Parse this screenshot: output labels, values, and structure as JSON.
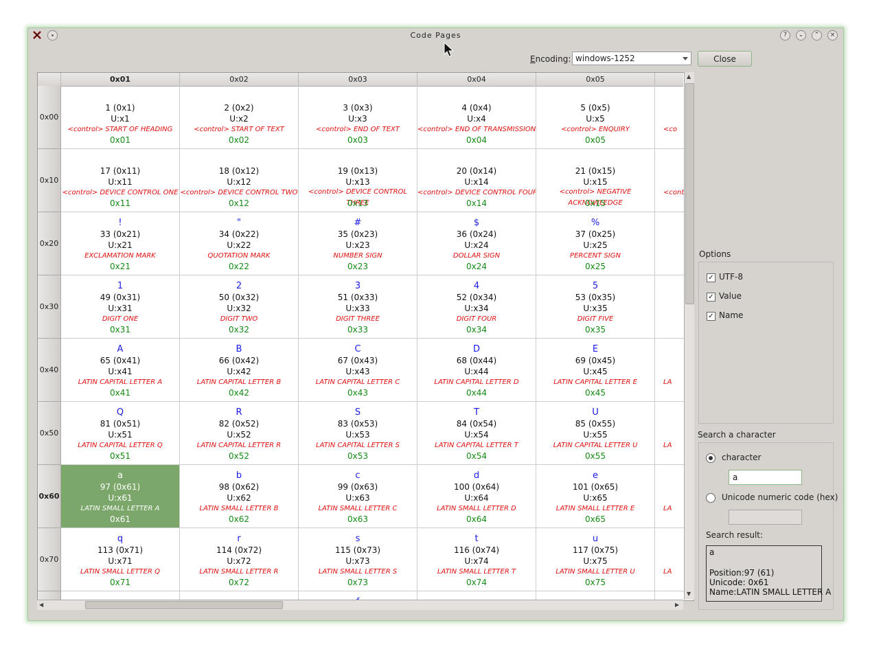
{
  "window": {
    "title": "Code Pages"
  },
  "toolbar": {
    "encoding_label_prefix": "E",
    "encoding_label_rest": "ncoding:",
    "encoding_value": "windows-1252",
    "close_label": "Close"
  },
  "columns": [
    "0x01",
    "0x02",
    "0x03",
    "0x04",
    "0x05"
  ],
  "rows": [
    {
      "label": "0x00",
      "cells": [
        {
          "ch": "",
          "val": "1 (0x1)",
          "uni": "U:x1",
          "name": "<control> START OF HEADING",
          "hex": "0x01"
        },
        {
          "ch": "",
          "val": "2 (0x2)",
          "uni": "U:x2",
          "name": "<control> START OF TEXT",
          "hex": "0x02"
        },
        {
          "ch": "",
          "val": "3 (0x3)",
          "uni": "U:x3",
          "name": "<control> END OF TEXT",
          "hex": "0x03"
        },
        {
          "ch": "",
          "val": "4 (0x4)",
          "uni": "U:x4",
          "name": "<control> END OF TRANSMISSION",
          "hex": "0x04"
        },
        {
          "ch": "",
          "val": "5 (0x5)",
          "uni": "U:x5",
          "name": "<control> ENQUIRY",
          "hex": "0x05"
        },
        {
          "ch": "",
          "val": "",
          "uni": "",
          "name": "<co",
          "hex": ""
        }
      ]
    },
    {
      "label": "0x10",
      "cells": [
        {
          "ch": "",
          "val": "17 (0x11)",
          "uni": "U:x11",
          "name": "<control> DEVICE CONTROL ONE",
          "hex": "0x11"
        },
        {
          "ch": "",
          "val": "18 (0x12)",
          "uni": "U:x12",
          "name": "<control> DEVICE CONTROL TWO",
          "hex": "0x12"
        },
        {
          "ch": "",
          "val": "19 (0x13)",
          "uni": "U:x13",
          "name": "<control> DEVICE CONTROL THREE",
          "hex": "0x13"
        },
        {
          "ch": "",
          "val": "20 (0x14)",
          "uni": "U:x14",
          "name": "<control> DEVICE CONTROL FOUR",
          "hex": "0x14"
        },
        {
          "ch": "",
          "val": "21 (0x15)",
          "uni": "U:x15",
          "name": "<control> NEGATIVE ACKNOWLEDGE",
          "hex": "0x15"
        },
        {
          "ch": "",
          "val": "",
          "uni": "",
          "name": "<contr",
          "hex": ""
        }
      ]
    },
    {
      "label": "0x20",
      "cells": [
        {
          "ch": "!",
          "val": "33 (0x21)",
          "uni": "U:x21",
          "name": "EXCLAMATION MARK",
          "hex": "0x21"
        },
        {
          "ch": "\"",
          "val": "34 (0x22)",
          "uni": "U:x22",
          "name": "QUOTATION MARK",
          "hex": "0x22"
        },
        {
          "ch": "#",
          "val": "35 (0x23)",
          "uni": "U:x23",
          "name": "NUMBER SIGN",
          "hex": "0x23"
        },
        {
          "ch": "$",
          "val": "36 (0x24)",
          "uni": "U:x24",
          "name": "DOLLAR SIGN",
          "hex": "0x24"
        },
        {
          "ch": "%",
          "val": "37 (0x25)",
          "uni": "U:x25",
          "name": "PERCENT SIGN",
          "hex": "0x25"
        },
        {
          "ch": "",
          "val": "",
          "uni": "",
          "name": "",
          "hex": ""
        }
      ]
    },
    {
      "label": "0x30",
      "cells": [
        {
          "ch": "1",
          "val": "49 (0x31)",
          "uni": "U:x31",
          "name": "DIGIT ONE",
          "hex": "0x31"
        },
        {
          "ch": "2",
          "val": "50 (0x32)",
          "uni": "U:x32",
          "name": "DIGIT TWO",
          "hex": "0x32"
        },
        {
          "ch": "3",
          "val": "51 (0x33)",
          "uni": "U:x33",
          "name": "DIGIT THREE",
          "hex": "0x33"
        },
        {
          "ch": "4",
          "val": "52 (0x34)",
          "uni": "U:x34",
          "name": "DIGIT FOUR",
          "hex": "0x34"
        },
        {
          "ch": "5",
          "val": "53 (0x35)",
          "uni": "U:x35",
          "name": "DIGIT FIVE",
          "hex": "0x35"
        },
        {
          "ch": "",
          "val": "",
          "uni": "",
          "name": "",
          "hex": ""
        }
      ]
    },
    {
      "label": "0x40",
      "cells": [
        {
          "ch": "A",
          "val": "65 (0x41)",
          "uni": "U:x41",
          "name": "LATIN CAPITAL LETTER A",
          "hex": "0x41"
        },
        {
          "ch": "B",
          "val": "66 (0x42)",
          "uni": "U:x42",
          "name": "LATIN CAPITAL LETTER B",
          "hex": "0x42"
        },
        {
          "ch": "C",
          "val": "67 (0x43)",
          "uni": "U:x43",
          "name": "LATIN CAPITAL LETTER C",
          "hex": "0x43"
        },
        {
          "ch": "D",
          "val": "68 (0x44)",
          "uni": "U:x44",
          "name": "LATIN CAPITAL LETTER D",
          "hex": "0x44"
        },
        {
          "ch": "E",
          "val": "69 (0x45)",
          "uni": "U:x45",
          "name": "LATIN CAPITAL LETTER E",
          "hex": "0x45"
        },
        {
          "ch": "",
          "val": "",
          "uni": "",
          "name": "LA",
          "hex": ""
        }
      ]
    },
    {
      "label": "0x50",
      "cells": [
        {
          "ch": "Q",
          "val": "81 (0x51)",
          "uni": "U:x51",
          "name": "LATIN CAPITAL LETTER Q",
          "hex": "0x51"
        },
        {
          "ch": "R",
          "val": "82 (0x52)",
          "uni": "U:x52",
          "name": "LATIN CAPITAL LETTER R",
          "hex": "0x52"
        },
        {
          "ch": "S",
          "val": "83 (0x53)",
          "uni": "U:x53",
          "name": "LATIN CAPITAL LETTER S",
          "hex": "0x53"
        },
        {
          "ch": "T",
          "val": "84 (0x54)",
          "uni": "U:x54",
          "name": "LATIN CAPITAL LETTER T",
          "hex": "0x54"
        },
        {
          "ch": "U",
          "val": "85 (0x55)",
          "uni": "U:x55",
          "name": "LATIN CAPITAL LETTER U",
          "hex": "0x55"
        },
        {
          "ch": "",
          "val": "",
          "uni": "",
          "name": "LA",
          "hex": ""
        }
      ]
    },
    {
      "label": "0x60",
      "cells": [
        {
          "ch": "a",
          "val": "97 (0x61)",
          "uni": "U:x61",
          "name": "LATIN SMALL LETTER A",
          "hex": "0x61",
          "selected": true
        },
        {
          "ch": "b",
          "val": "98 (0x62)",
          "uni": "U:x62",
          "name": "LATIN SMALL LETTER B",
          "hex": "0x62"
        },
        {
          "ch": "c",
          "val": "99 (0x63)",
          "uni": "U:x63",
          "name": "LATIN SMALL LETTER C",
          "hex": "0x63"
        },
        {
          "ch": "d",
          "val": "100 (0x64)",
          "uni": "U:x64",
          "name": "LATIN SMALL LETTER D",
          "hex": "0x64"
        },
        {
          "ch": "e",
          "val": "101 (0x65)",
          "uni": "U:x65",
          "name": "LATIN SMALL LETTER E",
          "hex": "0x65"
        },
        {
          "ch": "",
          "val": "",
          "uni": "",
          "name": "LA",
          "hex": ""
        }
      ]
    },
    {
      "label": "0x70",
      "cells": [
        {
          "ch": "q",
          "val": "113 (0x71)",
          "uni": "U:x71",
          "name": "LATIN SMALL LETTER Q",
          "hex": "0x71"
        },
        {
          "ch": "r",
          "val": "114 (0x72)",
          "uni": "U:x72",
          "name": "LATIN SMALL LETTER R",
          "hex": "0x72"
        },
        {
          "ch": "s",
          "val": "115 (0x73)",
          "uni": "U:x73",
          "name": "LATIN SMALL LETTER S",
          "hex": "0x73"
        },
        {
          "ch": "t",
          "val": "116 (0x74)",
          "uni": "U:x74",
          "name": "LATIN SMALL LETTER T",
          "hex": "0x74"
        },
        {
          "ch": "u",
          "val": "117 (0x75)",
          "uni": "U:x75",
          "name": "LATIN SMALL LETTER U",
          "hex": "0x75"
        },
        {
          "ch": "",
          "val": "",
          "uni": "",
          "name": "LA",
          "hex": ""
        }
      ]
    },
    {
      "label": "",
      "cells": [
        {
          "ch": "·",
          "val": "",
          "uni": "",
          "name": "",
          "hex": ""
        },
        {
          "ch": "",
          "val": "",
          "uni": "",
          "name": "",
          "hex": ""
        },
        {
          "ch": "f",
          "val": "",
          "uni": "",
          "name": "",
          "hex": ""
        },
        {
          "ch": "",
          "val": "",
          "uni": "",
          "name": "",
          "hex": ""
        },
        {
          "ch": "",
          "val": "",
          "uni": "",
          "name": "",
          "hex": ""
        },
        {
          "ch": "",
          "val": "",
          "uni": "",
          "name": "",
          "hex": ""
        }
      ]
    }
  ],
  "options": {
    "title": "Options",
    "items": [
      {
        "label": "UTF-8",
        "checked": true
      },
      {
        "label": "Value",
        "checked": true
      },
      {
        "label": "Name",
        "checked": true
      }
    ]
  },
  "search": {
    "title": "Search a character",
    "character_label": "character",
    "character_value": "a",
    "unicode_label": "Unicode numeric code (hex)",
    "unicode_value": "",
    "result_label": "Search result:",
    "result_char": "a",
    "result_position": "Position:97 (61)",
    "result_unicode": "Unicode: 0x61",
    "result_name": "Name:LATIN SMALL LETTER A"
  },
  "colors": {
    "selected_cell": "#7ba86a",
    "char": "#1a1ae6",
    "name": "#e01010",
    "hex": "#138a13"
  }
}
